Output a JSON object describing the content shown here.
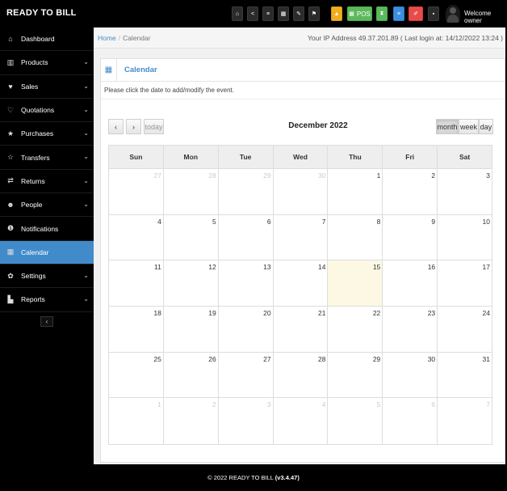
{
  "app": {
    "brand": "READY TO BILL"
  },
  "topbar": {
    "buttons": [
      {
        "icon": "home-icon",
        "glyph": "⌂"
      },
      {
        "icon": "share-icon",
        "glyph": "<"
      },
      {
        "icon": "list-icon",
        "glyph": "≡"
      },
      {
        "icon": "calendar-icon",
        "glyph": "▦"
      },
      {
        "icon": "edit-icon",
        "glyph": "✎"
      },
      {
        "icon": "flag-icon",
        "glyph": "⚑"
      },
      {
        "icon": "alert-icon",
        "glyph": "▲"
      },
      {
        "icon": "pos-icon",
        "glyph": "▦",
        "label": "POS"
      },
      {
        "icon": "hourglass-icon",
        "glyph": "⧗"
      },
      {
        "icon": "menu-icon",
        "glyph": "≡"
      },
      {
        "icon": "pencil-icon",
        "glyph": "✐"
      },
      {
        "icon": "grid-icon",
        "glyph": "▪"
      }
    ],
    "welcome": "Welcome owner"
  },
  "sidebar": {
    "items": [
      {
        "label": "Dashboard",
        "icon": "dashboard-icon",
        "glyph": "⌂",
        "has_submenu": false
      },
      {
        "label": "Products",
        "icon": "barcode-icon",
        "glyph": "▥",
        "has_submenu": true
      },
      {
        "label": "Sales",
        "icon": "heart-icon",
        "glyph": "♥",
        "has_submenu": true
      },
      {
        "label": "Quotations",
        "icon": "heart-outline-icon",
        "glyph": "♡",
        "has_submenu": true
      },
      {
        "label": "Purchases",
        "icon": "star-icon",
        "glyph": "★",
        "has_submenu": true
      },
      {
        "label": "Transfers",
        "icon": "star-outline-icon",
        "glyph": "☆",
        "has_submenu": true
      },
      {
        "label": "Returns",
        "icon": "random-icon",
        "glyph": "⇄",
        "has_submenu": true
      },
      {
        "label": "People",
        "icon": "users-icon",
        "glyph": "☻",
        "has_submenu": true
      },
      {
        "label": "Notifications",
        "icon": "info-icon",
        "glyph": "❶",
        "has_submenu": false
      },
      {
        "label": "Calendar",
        "icon": "calendar-icon",
        "glyph": "▦",
        "has_submenu": false
      },
      {
        "label": "Settings",
        "icon": "cog-icon",
        "glyph": "✿",
        "has_submenu": true
      },
      {
        "label": "Reports",
        "icon": "bar-chart-icon",
        "glyph": "▙",
        "has_submenu": true
      }
    ],
    "active": "Calendar",
    "collapse_glyph": "‹"
  },
  "breadcrumb": {
    "home": "Home",
    "separator": "/",
    "current": "Calendar"
  },
  "ip_info": "Your IP Address 49.37.201.89 ( Last login at: 14/12/2022 13:24 )",
  "panel": {
    "title": "Calendar",
    "hint": "Please click the date to add/modify the event."
  },
  "calendar": {
    "prev": "‹",
    "next": "›",
    "today": "today",
    "title": "December 2022",
    "views": [
      "month",
      "week",
      "day"
    ],
    "active_view": "month",
    "weekdays": [
      "Sun",
      "Mon",
      "Tue",
      "Wed",
      "Thu",
      "Fri",
      "Sat"
    ],
    "weeks": [
      [
        27,
        28,
        29,
        30,
        1,
        2,
        3
      ],
      [
        4,
        5,
        6,
        7,
        8,
        9,
        10
      ],
      [
        11,
        12,
        13,
        14,
        15,
        16,
        17
      ],
      [
        18,
        19,
        20,
        21,
        22,
        23,
        24
      ],
      [
        25,
        26,
        27,
        28,
        29,
        30,
        31
      ],
      [
        1,
        2,
        3,
        4,
        5,
        6,
        7
      ]
    ],
    "today_date": 15
  },
  "footer": {
    "text": "© 2022 READY TO BILL",
    "version": "(v3.4.47)"
  }
}
